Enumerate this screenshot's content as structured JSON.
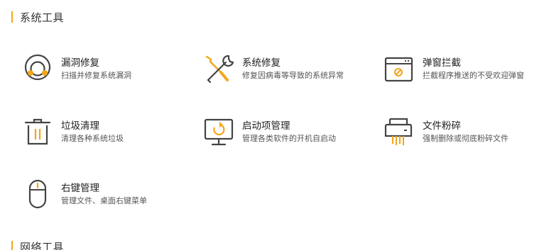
{
  "sections": [
    {
      "title": "系统工具"
    },
    {
      "title": "网络工具"
    }
  ],
  "tools": [
    {
      "icon": "bug-icon",
      "name": "漏洞修复",
      "desc": "扫描并修复系统漏洞"
    },
    {
      "icon": "wrench-screwdriver-icon",
      "name": "系统修复",
      "desc": "修复因病毒等导致的系统异常"
    },
    {
      "icon": "blocked-window-icon",
      "name": "弹窗拦截",
      "desc": "拦截程序推送的不受欢迎弹窗"
    },
    {
      "icon": "trash-icon",
      "name": "垃圾清理",
      "desc": "清理各种系统垃圾"
    },
    {
      "icon": "startup-monitor-icon",
      "name": "启动项管理",
      "desc": "管理各类软件的开机自启动"
    },
    {
      "icon": "shredder-icon",
      "name": "文件粉碎",
      "desc": "强制删除或彻底粉碎文件"
    },
    {
      "icon": "mouse-icon",
      "name": "右键管理",
      "desc": "管理文件、桌面右键菜单"
    }
  ],
  "colors": {
    "accent": "#f6a51a",
    "icon_stroke": "#444444"
  }
}
